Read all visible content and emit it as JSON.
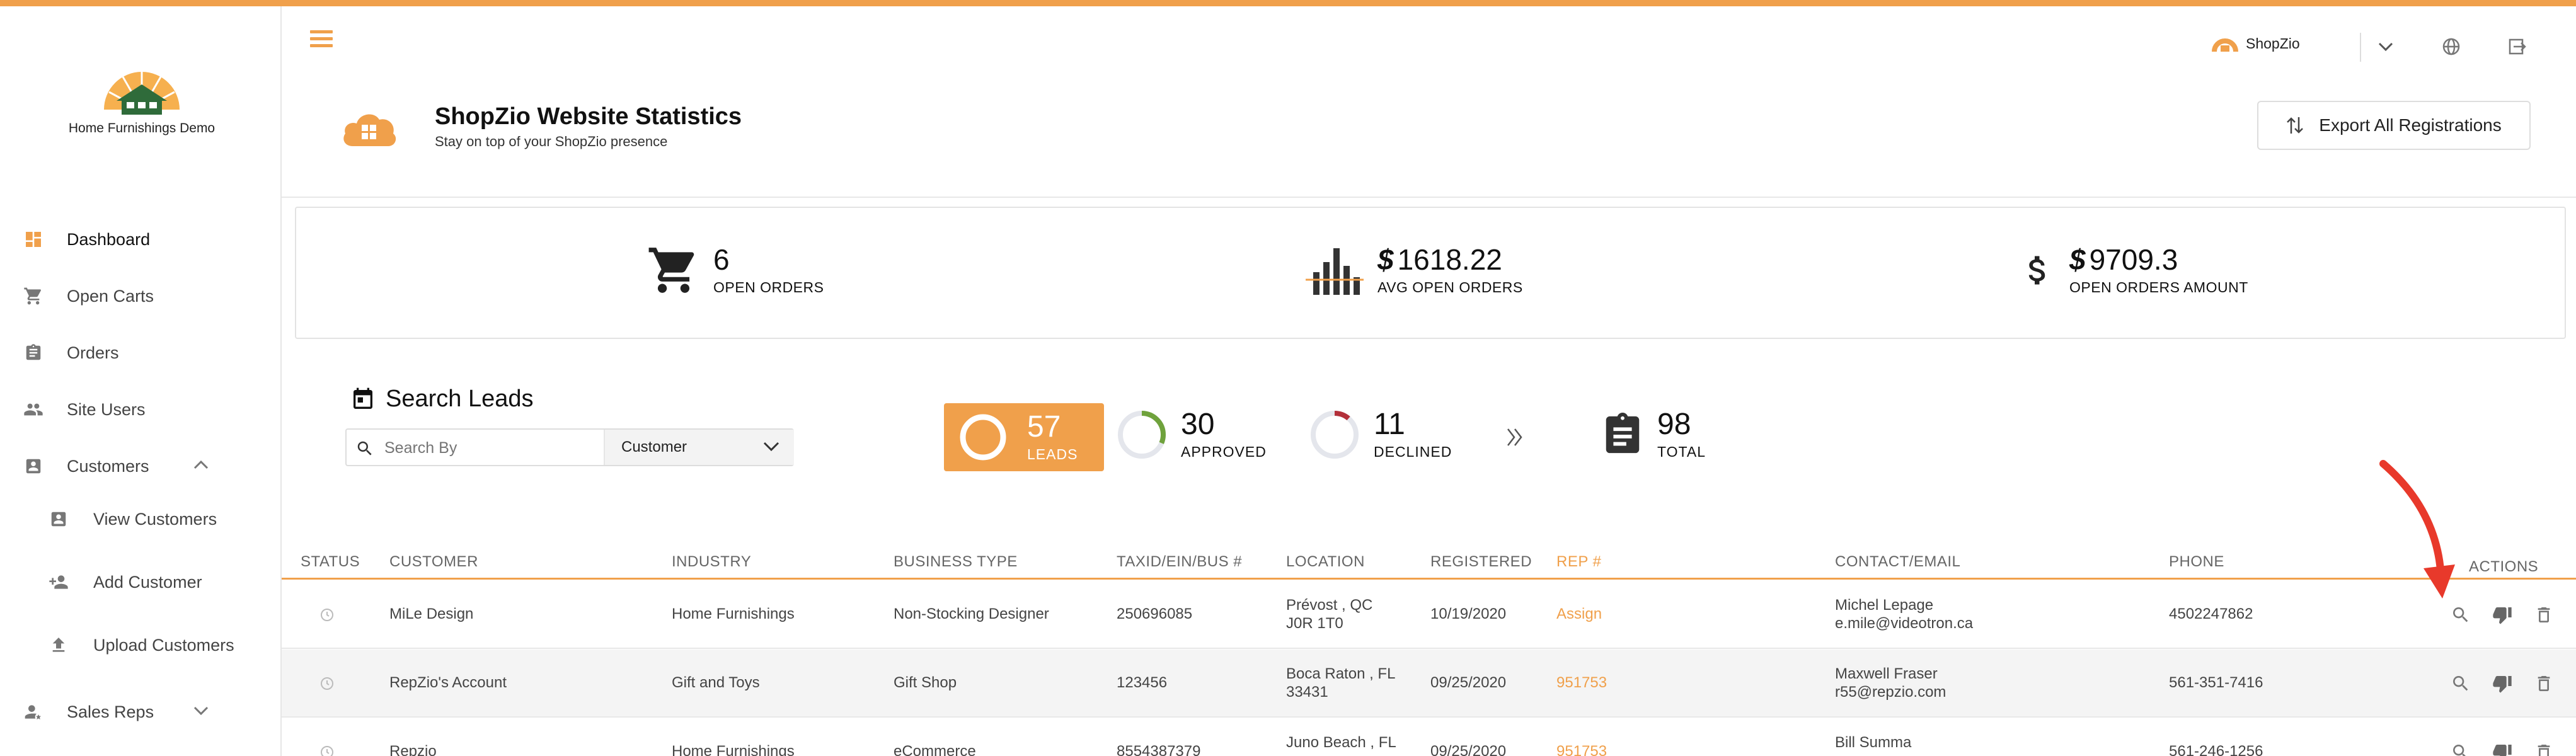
{
  "brand": {
    "company": "Home Furnishings Demo",
    "app_name": "ShopZio"
  },
  "colors": {
    "accent": "#f0a04b",
    "approved": "#6fa23c",
    "declined": "#b3303a"
  },
  "sidebar": {
    "items": [
      {
        "label": "Dashboard",
        "icon": "dashboard-icon"
      },
      {
        "label": "Open Carts",
        "icon": "cart-icon"
      },
      {
        "label": "Orders",
        "icon": "clipboard-icon"
      },
      {
        "label": "Site Users",
        "icon": "people-icon"
      },
      {
        "label": "Customers",
        "icon": "contact-card-icon"
      },
      {
        "label": "View Customers",
        "icon": "contact-card-icon"
      },
      {
        "label": "Add Customer",
        "icon": "add-person-icon"
      },
      {
        "label": "Upload Customers",
        "icon": "upload-icon"
      },
      {
        "label": "Sales Reps",
        "icon": "person-icon"
      }
    ]
  },
  "header": {
    "title": "ShopZio Website Statistics",
    "subtitle": "Stay on top of your ShopZio presence",
    "export_label": "Export All Registrations"
  },
  "stats": {
    "open_orders": {
      "value": "6",
      "label": "OPEN ORDERS"
    },
    "avg_open_orders": {
      "currency": "$",
      "value": "1618.22",
      "label": "AVG OPEN ORDERS"
    },
    "open_orders_amount": {
      "currency": "$",
      "value": "9709.3",
      "label": "OPEN ORDERS AMOUNT"
    }
  },
  "search": {
    "title": "Search Leads",
    "placeholder": "Search By",
    "filter_value": "Customer"
  },
  "kpis": {
    "leads": {
      "value": "57",
      "label": "LEADS"
    },
    "approved": {
      "value": "30",
      "label": "APPROVED"
    },
    "declined": {
      "value": "11",
      "label": "DECLINED"
    },
    "total": {
      "value": "98",
      "label": "TOTAL"
    }
  },
  "table": {
    "headers": [
      "STATUS",
      "CUSTOMER",
      "INDUSTRY",
      "BUSINESS TYPE",
      "TAXID/EIN/BUS #",
      "LOCATION",
      "REGISTERED",
      "REP #",
      "CONTACT/EMAIL",
      "PHONE",
      "ACTIONS"
    ],
    "rows": [
      {
        "customer": "MiLe Design",
        "industry": "Home Furnishings",
        "business_type": "Non-Stocking Designer",
        "taxid": "250696085",
        "location_1": "Prévost , QC",
        "location_2": "J0R 1T0",
        "registered": "10/19/2020",
        "rep": "Assign",
        "contact_name": "Michel Lepage",
        "contact_email": "e.mile@videotron.ca",
        "phone": "4502247862"
      },
      {
        "customer": "RepZio's Account",
        "industry": "Gift and Toys",
        "business_type": "Gift Shop",
        "taxid": "123456",
        "location_1": "Boca Raton , FL",
        "location_2": "33431",
        "registered": "09/25/2020",
        "rep": "951753",
        "contact_name": "Maxwell Fraser",
        "contact_email": "r55@repzio.com",
        "phone": "561-351-7416"
      },
      {
        "customer": "Repzio",
        "industry": "Home Furnishings",
        "business_type": "eCommerce",
        "taxid": "8554387379",
        "location_1": "Juno Beach , FL",
        "location_2": "",
        "registered": "09/25/2020",
        "rep": "951753",
        "contact_name": "Bill Summa",
        "contact_email": "",
        "phone": "561-246-1256"
      }
    ]
  }
}
